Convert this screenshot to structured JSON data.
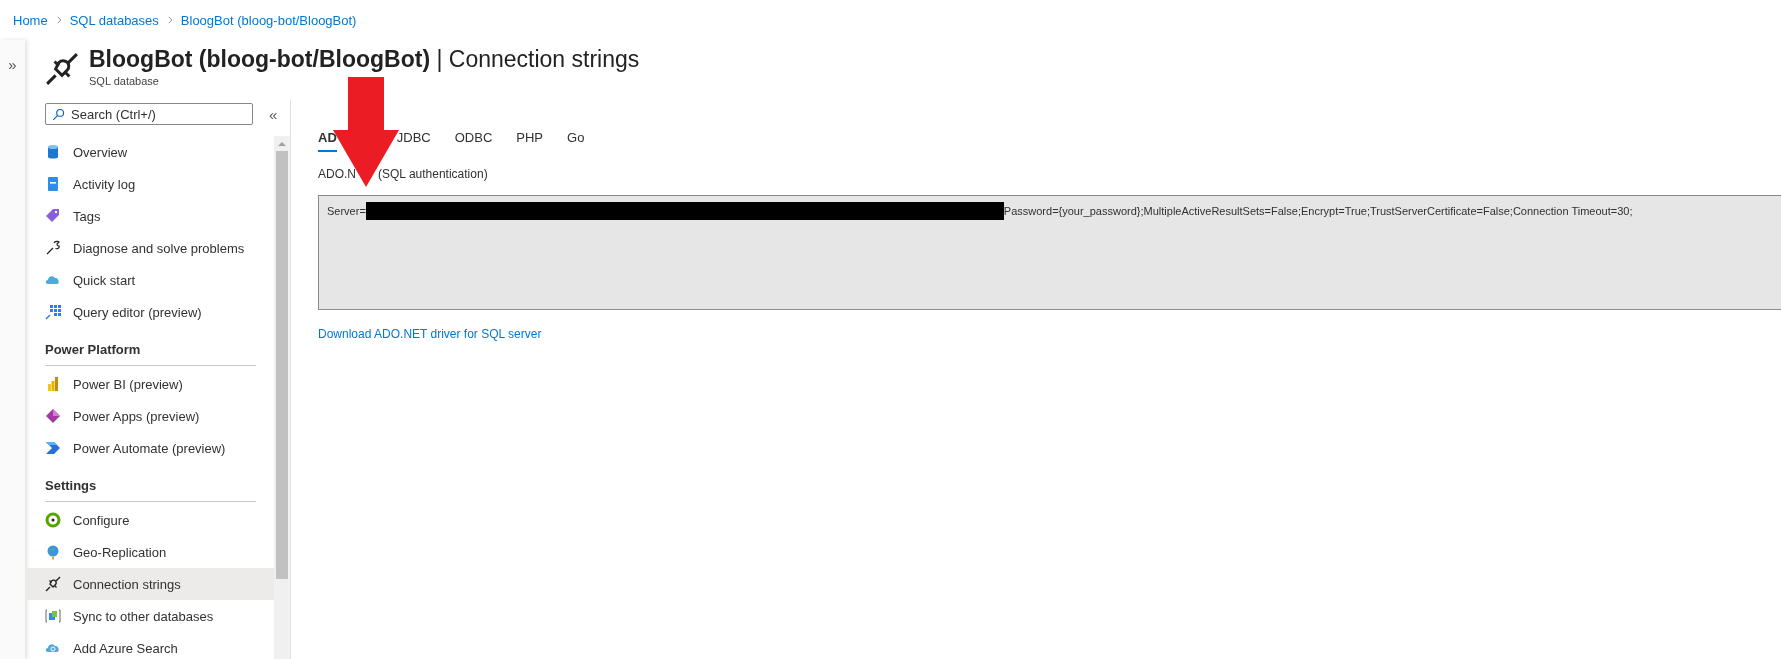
{
  "breadcrumb": [
    "Home",
    "SQL databases",
    "BloogBot (bloog-bot/BloogBot)"
  ],
  "header": {
    "title": "**BloogBot (bloog-bot/BloogBot)** | Connection strings",
    "subtitle": "SQL database"
  },
  "sidebar": {
    "search": {
      "placeholder": "Search (Ctrl+/)"
    },
    "collapse": "«",
    "groups": [
      {
        "items": [
          {
            "label": "Overview",
            "selected": false
          },
          {
            "label": "Activity log",
            "selected": false
          },
          {
            "label": "Tags",
            "selected": false
          },
          {
            "label": "Diagnose and solve problems",
            "selected": false
          },
          {
            "label": "Quick start",
            "selected": false
          },
          {
            "label": "Query editor (preview)",
            "selected": false
          }
        ]
      },
      {
        "heading": "Power Platform",
        "items": [
          {
            "label": "Power BI (preview)",
            "selected": false
          },
          {
            "label": "Power Apps (preview)",
            "selected": false
          },
          {
            "label": "Power Automate (preview)",
            "selected": false
          }
        ]
      },
      {
        "heading": "Settings",
        "items": [
          {
            "label": "Configure",
            "selected": false
          },
          {
            "label": "Geo-Replication",
            "selected": false
          },
          {
            "label": "Connection strings",
            "selected": true
          },
          {
            "label": "Sync to other databases",
            "selected": false
          },
          {
            "label": "Add Azure Search",
            "selected": false
          }
        ]
      }
    ]
  },
  "expand_strip": "»",
  "tabs": [
    {
      "label": "AD",
      "selected": true
    },
    {
      "label": "JDBC",
      "selected": false
    },
    {
      "label": "ODBC",
      "selected": false
    },
    {
      "label": "PHP",
      "selected": false
    },
    {
      "label": "Go",
      "selected": false
    }
  ],
  "section_label": [
    "ADO.N",
    "(SQL authentication)"
  ],
  "connection_string": {
    "before": "Server=",
    "redacted": true,
    "after": "Password={your_password};MultipleActiveResultSets=False;Encrypt=True;TrustServerCertificate=False;Connection Timeout=30;"
  },
  "link": "Download ADO.NET driver for SQL server"
}
